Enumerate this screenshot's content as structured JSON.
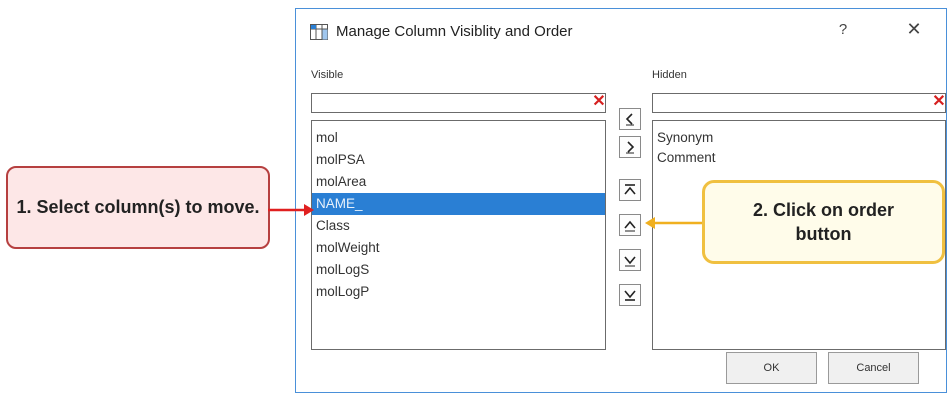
{
  "dialog": {
    "title": "Manage Column Visiblity and Order",
    "help_glyph": "?",
    "close_glyph": "✕"
  },
  "visible_panel": {
    "label": "Visible",
    "filter_value": "",
    "items": [
      "mol",
      "molPSA",
      "molArea",
      "NAME_",
      "Class",
      "molWeight",
      "molLogS",
      "molLogP"
    ],
    "selected": "NAME_"
  },
  "hidden_panel": {
    "label": "Hidden",
    "filter_value": "",
    "items": [
      "Synonym",
      "Comment"
    ]
  },
  "buttons": {
    "ok": "OK",
    "cancel": "Cancel"
  },
  "order_buttons": [
    "move-left",
    "move-right",
    "move-to-top",
    "move-up",
    "move-down",
    "move-to-bottom"
  ],
  "callouts": {
    "select_text": "1. Select column(s) to move.",
    "order_text": "2. Click on order button"
  },
  "colors": {
    "selection": "#2a7fd4",
    "clear_x": "#d62020",
    "red_arrow": "#e02020",
    "yellow_arrow": "#f0b020",
    "callout1_border": "#b64040",
    "callout2_border": "#f0c040"
  }
}
